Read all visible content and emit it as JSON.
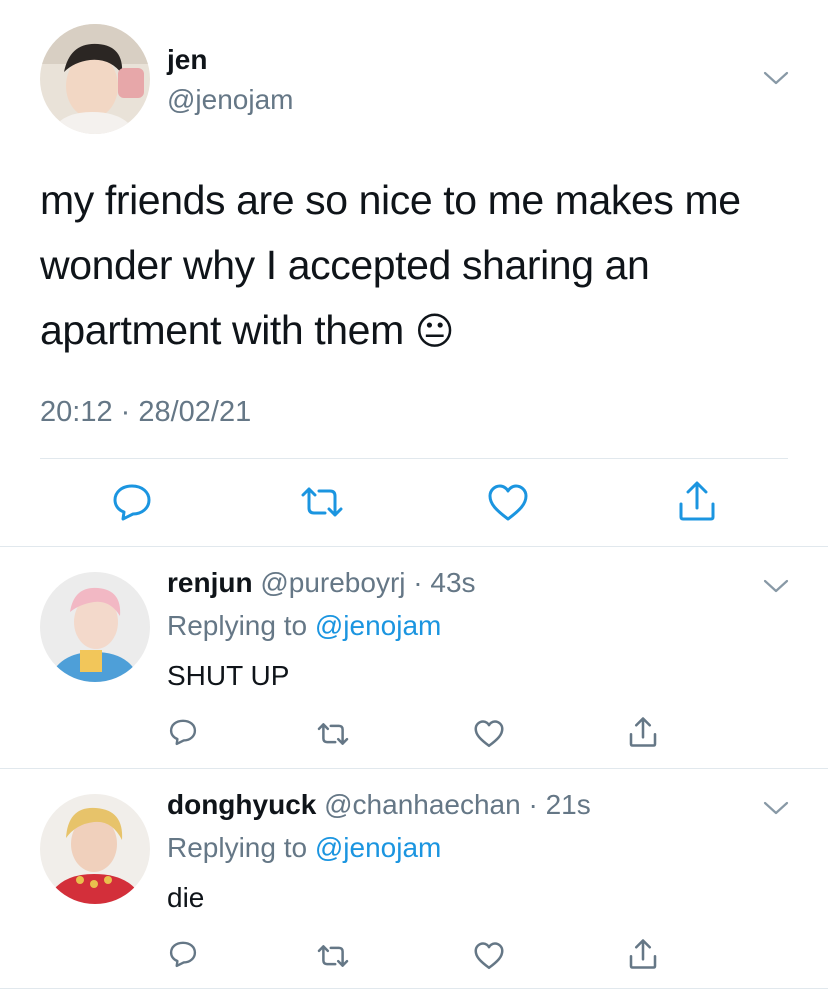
{
  "main_tweet": {
    "display_name": "jen",
    "handle": "@jenojam",
    "text": "my friends are so nice to me makes me wonder why I accepted sharing an apartment with them",
    "emoji": "😐",
    "timestamp": "20:12 · 28/02/21"
  },
  "replies": [
    {
      "display_name": "renjun",
      "handle": "@pureboyrj",
      "time": "· 43s",
      "replying_prefix": "Replying to",
      "replying_handle": "@jenojam",
      "text": "SHUT UP"
    },
    {
      "display_name": "donghyuck",
      "handle": "@chanhaechan",
      "time": "· 21s",
      "replying_prefix": "Replying to",
      "replying_handle": "@jenojam",
      "text": "die"
    }
  ],
  "colors": {
    "link": "#1b95e0",
    "muted": "#657786",
    "divider": "#e1e8ed",
    "icon": "#1b95e0"
  },
  "icons": [
    "chevron-down-icon",
    "reply-icon",
    "retweet-icon",
    "like-icon",
    "share-icon"
  ]
}
